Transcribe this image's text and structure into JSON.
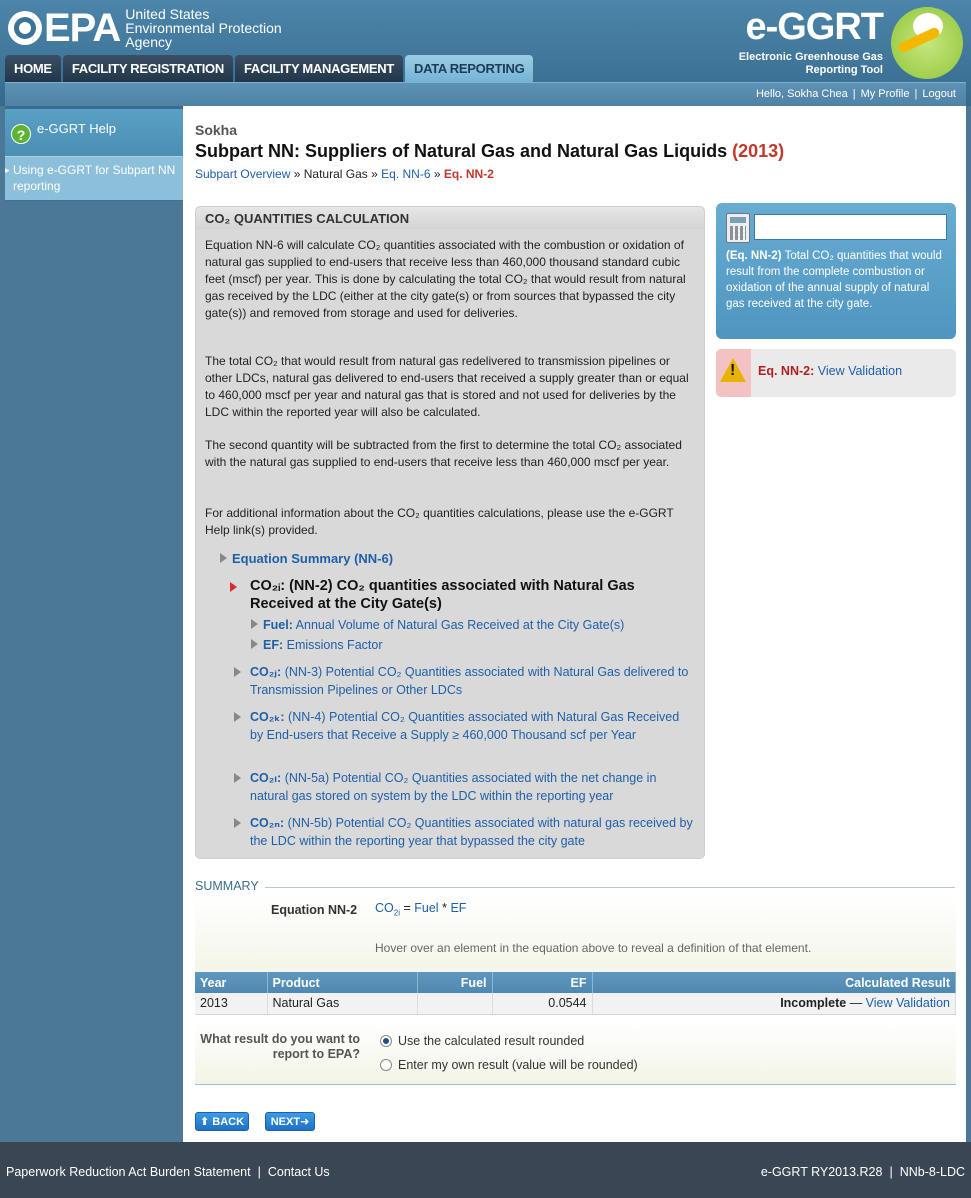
{
  "header": {
    "agency_line1": "United States",
    "agency_line2": "Environmental Protection",
    "agency_line3": "Agency",
    "agency_short": "EPA",
    "app_title": "e-GGRT",
    "app_subtitle_1": "Electronic Greenhouse Gas",
    "app_subtitle_2": "Reporting Tool"
  },
  "nav": {
    "tabs": [
      {
        "label": "HOME"
      },
      {
        "label": "FACILITY REGISTRATION"
      },
      {
        "label": "FACILITY MANAGEMENT"
      },
      {
        "label": "DATA REPORTING"
      }
    ]
  },
  "userbar": {
    "greeting": "Hello, Sokha Chea",
    "profile": "My Profile",
    "logout": "Logout"
  },
  "sidebar": {
    "help": "e-GGRT Help",
    "item": "Using e-GGRT for Subpart NN reporting"
  },
  "page": {
    "facility": "Sokha",
    "title": "Subpart NN: Suppliers of Natural Gas and Natural Gas Liquids",
    "year": "(2013)",
    "breadcrumb": {
      "overview": "Subpart Overview",
      "sep": "»",
      "natural_gas": "Natural Gas",
      "nn6": "Eq. NN-6",
      "nn2": "Eq. NN-2"
    }
  },
  "calc": {
    "heading": "CO₂ QUANTITIES CALCULATION",
    "para1": "Equation NN-6 will calculate CO₂ quantities associated with the combustion or oxidation of natural gas supplied to end-users that receive less than 460,000 thousand standard cubic feet (mscf) per year. This is done by calculating the total CO₂ that would result from natural gas received by the LDC (either at the city gate(s) or from sources that bypassed the city gate(s)) and removed from storage and used for deliveries.",
    "para2": "The total CO₂ that would result from natural gas redelivered to transmission pipelines or other LDCs, natural gas delivered to end-users that received a supply greater than or equal to 460,000 mscf per year and natural gas that is stored and not used for deliveries by the LDC within the reported year will also be calculated.",
    "para3": "The second quantity will be subtracted from the first to determine the total CO₂ associated with the natural gas supplied to end-users that receive less than 460,000 mscf per year.",
    "para4": "For additional information about the CO₂ quantities calculations, please use the e-GGRT Help link(s) provided.",
    "eq_summary": "Equation Summary (NN-6)",
    "main_node": "CO₂ᵢ: (NN-2) CO₂ quantities associated with Natural Gas Received at the City Gate(s)",
    "leaf_fuel_key": "Fuel:",
    "leaf_fuel": "Annual Volume of Natural Gas Received at the City Gate(s)",
    "leaf_ef_key": "EF:",
    "leaf_ef": "Emissions Factor",
    "node_j_key": "CO₂ⱼ:",
    "node_j": "(NN-3) Potential CO₂ Quantities associated with Natural Gas delivered to Transmission Pipelines or Other LDCs",
    "node_k_key": "CO₂ₖ:",
    "node_k": "(NN-4) Potential CO₂ Quantities associated with Natural Gas Received by End-users that Receive a Supply ≥ 460,000 Thousand scf per Year",
    "node_l_key": "CO₂ₗ:",
    "node_l": "(NN-5a) Potential CO₂ Quantities associated with the net change in natural gas stored on system by the LDC within the reporting year",
    "node_n_key": "CO₂ₙ:",
    "node_n": "(NN-5b) Potential CO₂ Quantities associated with natural gas received by the LDC within the reporting year that bypassed the city gate"
  },
  "calc_box": {
    "eq": "(Eq. NN-2)",
    "desc": "Total CO₂ quantities that would result from the complete combustion or oxidation of the annual supply of natural gas received at the city gate."
  },
  "validation": {
    "eq": "Eq. NN-2:",
    "link": "View Validation"
  },
  "summary": {
    "label": "SUMMARY",
    "eq_label": "Equation NN-2",
    "co2": "CO",
    "co2_sub": "2i",
    "eq_sign": "=",
    "fuel": "Fuel",
    "times": "*",
    "ef": "EF",
    "hint": "Hover over an element in the equation above to reveal a definition of that element."
  },
  "table": {
    "headers": [
      "Year",
      "Product",
      "Fuel",
      "EF",
      "Calculated Result"
    ],
    "row": {
      "year": "2013",
      "product": "Natural Gas",
      "fuel": "",
      "ef": "0.0544",
      "result": "Incomplete",
      "dash": "—",
      "link": "View Validation"
    }
  },
  "report": {
    "question": "What result do you want to report to EPA?",
    "opt1": "Use the calculated result rounded",
    "opt2": "Enter my own result (value will be rounded)"
  },
  "buttons": {
    "back": "BACK",
    "next": "NEXT"
  },
  "footer": {
    "paperwork": "Paperwork Reduction Act Burden Statement",
    "contact": "Contact Us",
    "version": "e-GGRT RY2013.R28",
    "code": "NNb-8-LDC"
  }
}
